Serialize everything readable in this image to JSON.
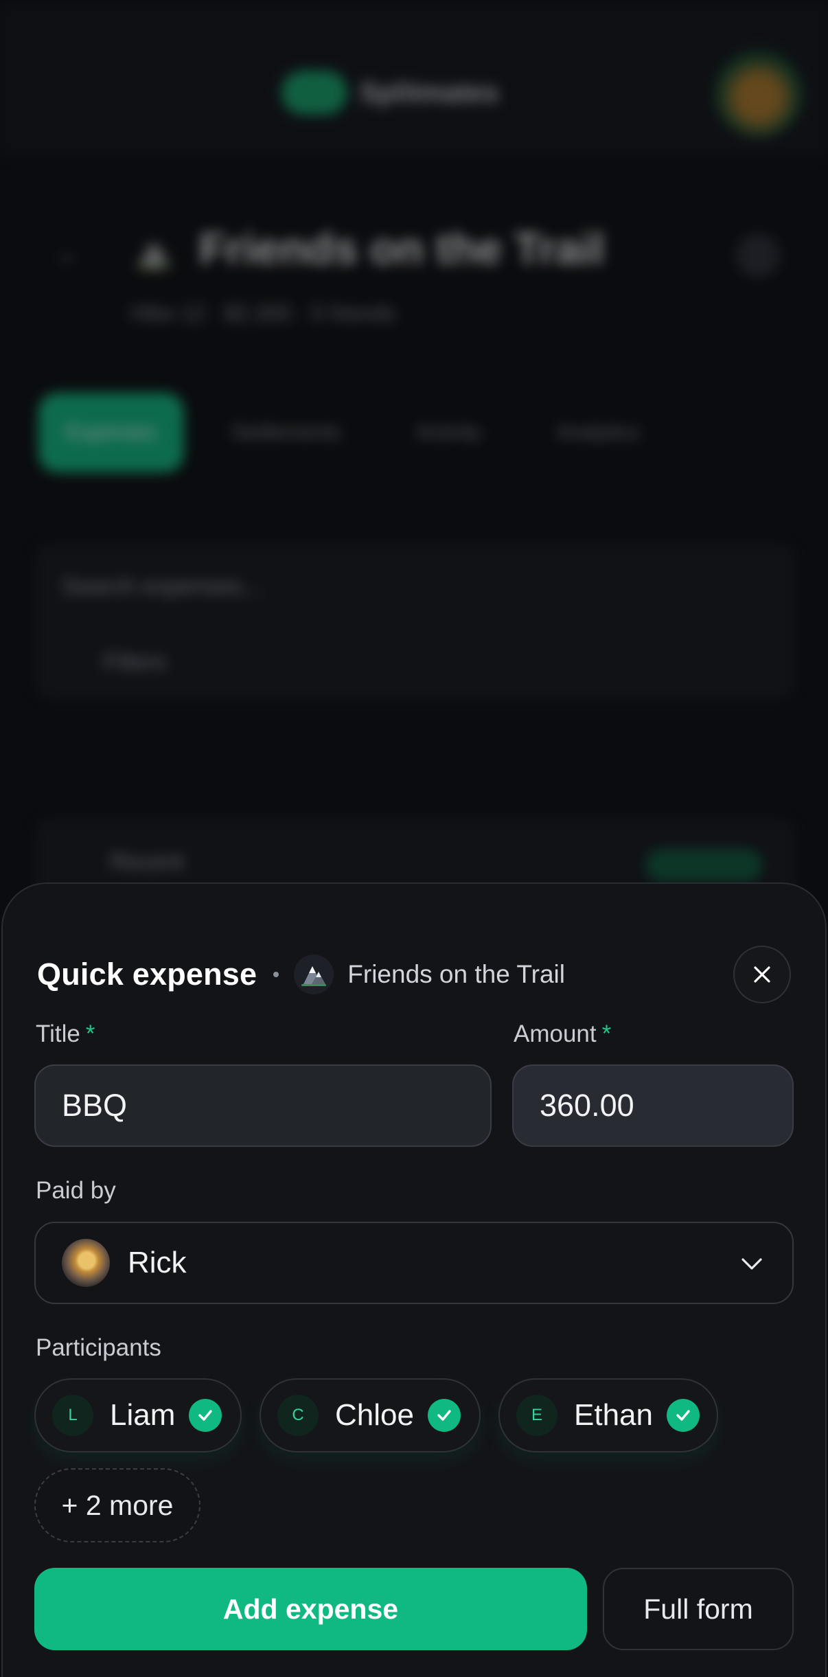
{
  "background": {
    "app_logo_text": "Splitmates",
    "group_emoji": "⛰️",
    "group_title": "Friends on the Trail",
    "group_subtitle": "Hike 12 · $2,300 · 5 friends",
    "tabs": [
      "Expenses",
      "Settlements",
      "Activity",
      "Analytics"
    ],
    "search_placeholder": "Search expenses...",
    "filter_label": "Filters",
    "list_item_label": "Recent"
  },
  "sheet": {
    "title": "Quick expense",
    "group_name": "Friends on the Trail",
    "group_icon": "mountain-icon",
    "close_icon": "close-icon"
  },
  "form": {
    "title_label": "Title",
    "title_value": "BBQ",
    "amount_label": "Amount",
    "amount_value": "360.00",
    "required_mark": "*",
    "paid_by_label": "Paid by",
    "paid_by_value": "Rick",
    "participants_label": "Participants",
    "participants": [
      {
        "initial": "L",
        "name": "Liam",
        "selected": true
      },
      {
        "initial": "C",
        "name": "Chloe",
        "selected": true
      },
      {
        "initial": "E",
        "name": "Ethan",
        "selected": true
      }
    ],
    "more_label": "+ 2 more"
  },
  "actions": {
    "primary_label": "Add expense",
    "secondary_label": "Full form"
  },
  "colors": {
    "accent": "#10b981",
    "sheet_bg": "#131418",
    "page_bg": "#0b0c0f"
  }
}
